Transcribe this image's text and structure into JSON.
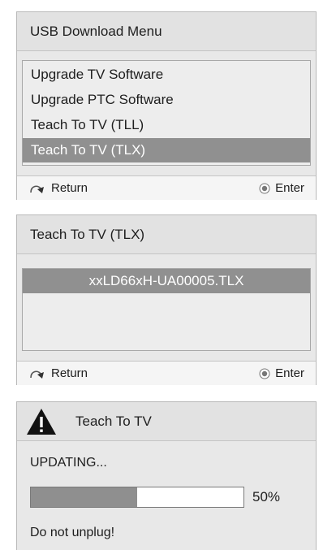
{
  "menu_panel": {
    "title": "USB Download Menu",
    "items": [
      {
        "label": "Upgrade TV Software",
        "selected": false
      },
      {
        "label": "Upgrade PTC Software",
        "selected": false
      },
      {
        "label": "Teach To TV (TLL)",
        "selected": false
      },
      {
        "label": "Teach To TV (TLX)",
        "selected": true
      }
    ],
    "footer": {
      "return_label": "Return",
      "enter_label": "Enter"
    }
  },
  "file_panel": {
    "title": "Teach To TV (TLX)",
    "files": [
      {
        "label": "xxLD66xH-UA00005.TLX",
        "selected": true
      }
    ],
    "footer": {
      "return_label": "Return",
      "enter_label": "Enter"
    }
  },
  "update_panel": {
    "title": "Teach To TV",
    "status": "UPDATING...",
    "progress_percent": 50,
    "progress_label": "50%",
    "warning": "Do not unplug!"
  },
  "colors": {
    "panel_bg": "#e8e8e8",
    "selected_bg": "#909090",
    "progress_fill": "#8f8f8f"
  },
  "icons": {
    "return": "return-arrow-icon",
    "enter": "enter-radio-icon",
    "warning": "warning-triangle-icon"
  }
}
